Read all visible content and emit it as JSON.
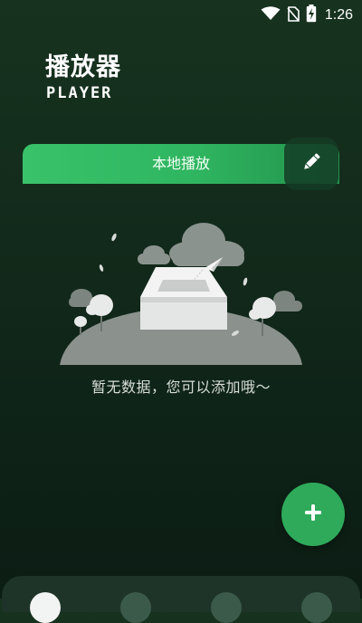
{
  "status_bar": {
    "time": "1:26",
    "icons": [
      "wifi-icon",
      "no-sim-icon",
      "battery-charging-icon"
    ]
  },
  "header": {
    "title": "播放器",
    "subtitle": "PLAYER"
  },
  "tabs": {
    "local_play_label": "本地播放",
    "edit_icon": "pencil-icon"
  },
  "empty_state": {
    "message": "暂无数据，您可以添加哦～",
    "illustration": "empty-box-illustration"
  },
  "fab": {
    "icon": "plus-icon"
  },
  "bottom_nav": {
    "items": [
      {
        "icon": "nav-dot",
        "active": true
      },
      {
        "icon": "nav-dot",
        "active": false
      },
      {
        "icon": "nav-dot",
        "active": false
      },
      {
        "icon": "nav-dot",
        "active": false
      }
    ]
  },
  "colors": {
    "accent": "#2eaa5a",
    "background": "#122a1b"
  }
}
